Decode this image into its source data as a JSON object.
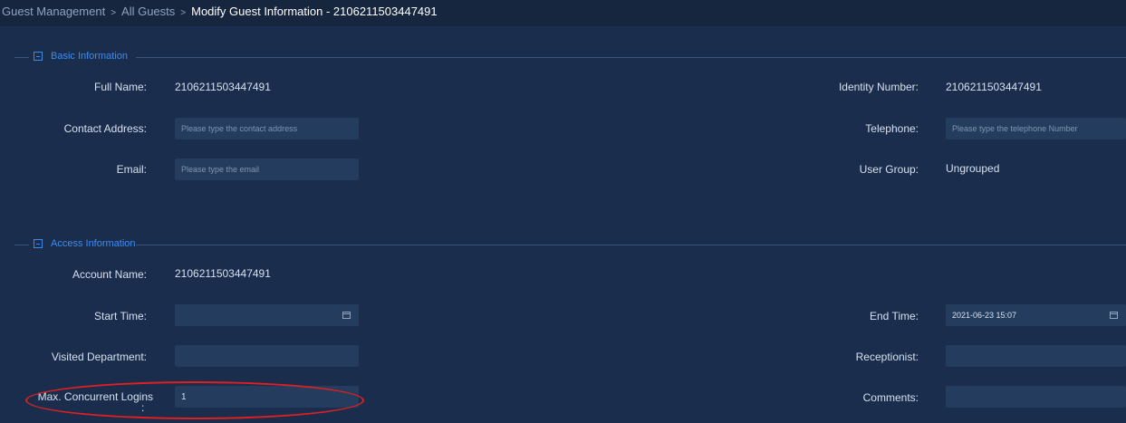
{
  "breadcrumb": {
    "items": [
      "Guest Management",
      "All Guests"
    ],
    "separator": ">",
    "current": "Modify Guest Information - 2106211503447491"
  },
  "basic_section": {
    "title": "Basic Information",
    "full_name_label": "Full Name:",
    "full_name_value": "2106211503447491",
    "identity_label": "Identity Number:",
    "identity_value": "2106211503447491",
    "contact_address_label": "Contact Address:",
    "contact_address_placeholder": "Please type the contact address",
    "telephone_label": "Telephone:",
    "telephone_placeholder": "Please type the telephone Number",
    "email_label": "Email:",
    "email_placeholder": "Please type the email",
    "user_group_label": "User Group:",
    "user_group_value": "Ungrouped"
  },
  "access_section": {
    "title": "Access Information",
    "account_name_label": "Account Name:",
    "account_name_value": "2106211503447491",
    "start_time_label": "Start Time:",
    "start_time_value": "",
    "end_time_label": "End Time:",
    "end_time_value": "2021-06-23 15:07",
    "visited_department_label": "Visited Department:",
    "visited_department_value": "",
    "receptionist_label": "Receptionist:",
    "receptionist_value": "",
    "max_logins_label": "Max. Concurrent Logins",
    "max_logins_colon": ":",
    "max_logins_value": "1",
    "comments_label": "Comments:",
    "comments_value": ""
  },
  "colors": {
    "background": "#1a2d4c",
    "input_bg": "#243c5e",
    "accent": "#3d8cf0",
    "highlight": "#e02020"
  }
}
